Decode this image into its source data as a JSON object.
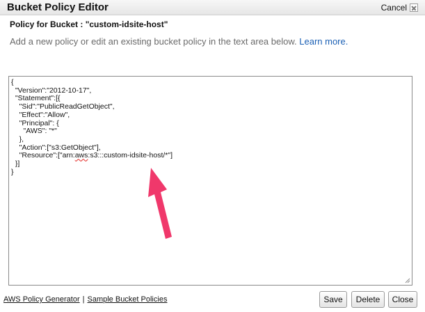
{
  "dialog": {
    "title": "Bucket Policy Editor",
    "cancel_label": "Cancel",
    "subheading": "Policy for Bucket : \"custom-idsite-host\"",
    "description": "Add a new policy or edit an existing bucket policy in the text area below.",
    "learn_more": "Learn more."
  },
  "editor": {
    "lines": [
      "{",
      "  \"Version\":\"2012-10-17\",",
      "  \"Statement\":[{",
      "    \"Sid\":\"PublicReadGetObject\",",
      "    \"Effect\":\"Allow\",",
      "    \"Principal\": {",
      "      \"AWS\": \"*\"",
      "    },",
      "    \"Action\":[\"s3:GetObject\"],"
    ],
    "resource_prefix": "    \"Resource\":[\"arn:",
    "resource_misspelled": "aws",
    "resource_suffix": ":s3:::custom-idsite-host/*\"]",
    "closing_lines": [
      "  }]",
      "}"
    ]
  },
  "footer": {
    "policy_generator": "AWS Policy Generator",
    "separator": "|",
    "sample_policies": "Sample Bucket Policies"
  },
  "buttons": {
    "save": "Save",
    "delete": "Delete",
    "close": "Close"
  },
  "colors": {
    "arrow": "#f0386b",
    "link": "#1a5fb4",
    "spellcheck": "#e53935"
  }
}
